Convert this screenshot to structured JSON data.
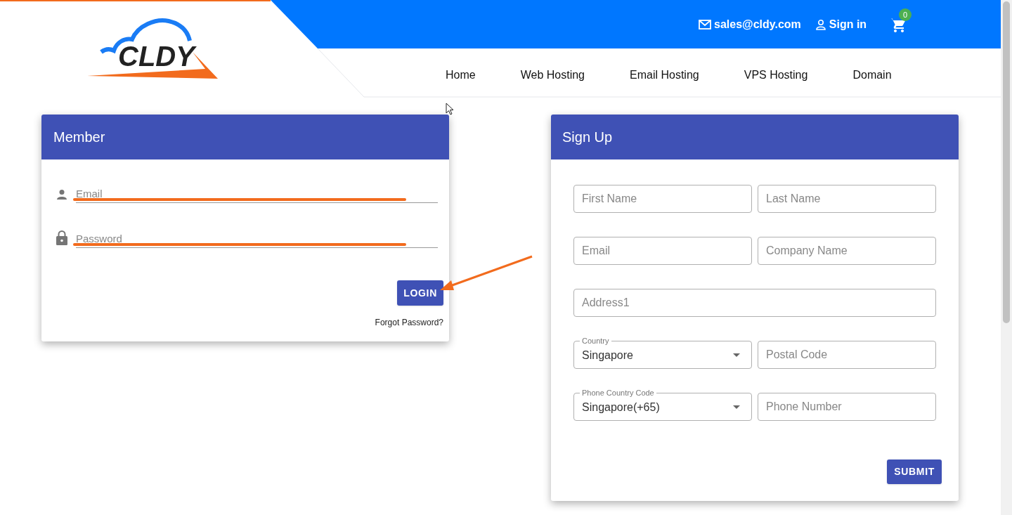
{
  "header": {
    "logo": {
      "text": "CLDY"
    },
    "email": "sales@cldy.com",
    "sign_in": "Sign in",
    "cart_count": "0"
  },
  "nav": {
    "items": [
      {
        "label": "Home"
      },
      {
        "label": "Web Hosting"
      },
      {
        "label": "Email Hosting"
      },
      {
        "label": "VPS Hosting"
      },
      {
        "label": "Domain"
      }
    ]
  },
  "member": {
    "title": "Member",
    "fields": [
      {
        "kind": "email",
        "placeholder": "Email",
        "annotated": true
      },
      {
        "kind": "password",
        "placeholder": "Password",
        "annotated": true
      }
    ],
    "login_button": {
      "label": "LOGIN",
      "annotated": true
    },
    "forgot_link": "Forgot Password?"
  },
  "signup": {
    "title": "Sign Up",
    "rows": [
      [
        {
          "kind": "text",
          "placeholder": "First Name"
        },
        {
          "kind": "text",
          "placeholder": "Last Name"
        }
      ],
      [
        {
          "kind": "text",
          "placeholder": "Email"
        },
        {
          "kind": "text",
          "placeholder": "Company Name"
        }
      ],
      [
        {
          "kind": "text",
          "placeholder": "Address1"
        }
      ],
      [
        {
          "kind": "select",
          "label": "Country",
          "value": "Singapore"
        },
        {
          "kind": "text",
          "placeholder": "Postal Code"
        }
      ],
      [
        {
          "kind": "select",
          "label": "Phone Country Code",
          "value": "Singapore(+65)"
        },
        {
          "kind": "text",
          "placeholder": "Phone Number"
        }
      ]
    ],
    "submit_button": "SUBMIT"
  }
}
